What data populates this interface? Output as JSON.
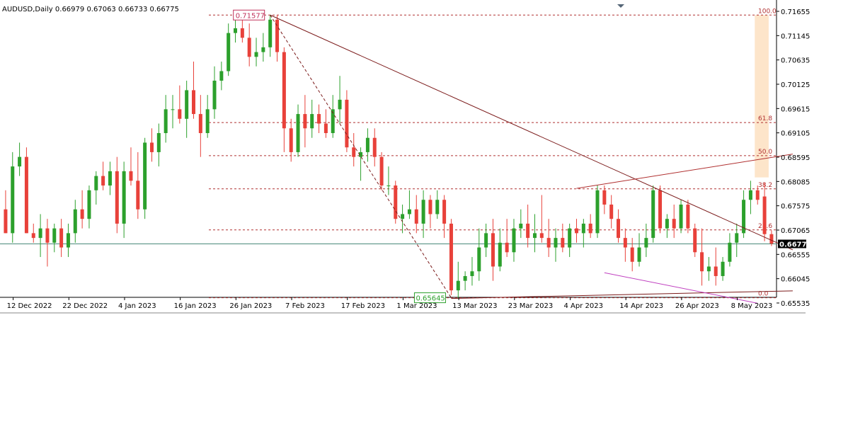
{
  "header": {
    "symbol": "AUDUSD,Daily",
    "ohlc": "0.66979 0.67063 0.66733 0.66775"
  },
  "colors": {
    "bull": "#2ca02c",
    "bear": "#e8413a",
    "trendline": "#7b1a1a",
    "fib": "#b03030",
    "support": "#c040c0",
    "highlight": "#fde2c4",
    "bid_line": "#4a8a7a"
  },
  "chart_data": {
    "type": "candlestick",
    "ylim": [
      0.65535,
      0.71655
    ],
    "y_ticks": [
      "0.71655",
      "0.71145",
      "0.70635",
      "0.70125",
      "0.69615",
      "0.69105",
      "0.68595",
      "0.68085",
      "0.67575",
      "0.67065",
      "0.66555",
      "0.66045",
      "0.65535"
    ],
    "x_labels": [
      {
        "label": "12 Dec 2022",
        "bar": 2
      },
      {
        "label": "22 Dec 2022",
        "bar": 10
      },
      {
        "label": "4 Jan 2023",
        "bar": 18
      },
      {
        "label": "16 Jan 2023",
        "bar": 26
      },
      {
        "label": "26 Jan 2023",
        "bar": 34
      },
      {
        "label": "7 Feb 2023",
        "bar": 42
      },
      {
        "label": "17 Feb 2023",
        "bar": 50
      },
      {
        "label": "1 Mar 2023",
        "bar": 58
      },
      {
        "label": "13 Mar 2023",
        "bar": 66
      },
      {
        "label": "23 Mar 2023",
        "bar": 74
      },
      {
        "label": "4 Apr 2023",
        "bar": 82
      },
      {
        "label": "14 Apr 2023",
        "bar": 90
      },
      {
        "label": "26 Apr 2023",
        "bar": 98
      },
      {
        "label": "8 May 2023",
        "bar": 106
      }
    ],
    "bars": 110,
    "candles": [
      [
        0.675,
        0.679,
        0.67,
        0.67
      ],
      [
        0.67,
        0.687,
        0.668,
        0.684
      ],
      [
        0.684,
        0.689,
        0.682,
        0.686
      ],
      [
        0.686,
        0.688,
        0.67,
        0.67
      ],
      [
        0.67,
        0.672,
        0.668,
        0.669
      ],
      [
        0.669,
        0.674,
        0.665,
        0.671
      ],
      [
        0.671,
        0.673,
        0.663,
        0.668
      ],
      [
        0.668,
        0.672,
        0.666,
        0.671
      ],
      [
        0.671,
        0.673,
        0.665,
        0.667
      ],
      [
        0.667,
        0.672,
        0.665,
        0.67
      ],
      [
        0.67,
        0.677,
        0.668,
        0.675
      ],
      [
        0.675,
        0.679,
        0.671,
        0.673
      ],
      [
        0.673,
        0.68,
        0.671,
        0.679
      ],
      [
        0.679,
        0.683,
        0.676,
        0.682
      ],
      [
        0.682,
        0.685,
        0.679,
        0.68
      ],
      [
        0.68,
        0.685,
        0.678,
        0.683
      ],
      [
        0.683,
        0.686,
        0.67,
        0.672
      ],
      [
        0.672,
        0.685,
        0.669,
        0.683
      ],
      [
        0.683,
        0.688,
        0.68,
        0.681
      ],
      [
        0.681,
        0.687,
        0.673,
        0.675
      ],
      [
        0.675,
        0.69,
        0.673,
        0.689
      ],
      [
        0.689,
        0.692,
        0.685,
        0.687
      ],
      [
        0.687,
        0.693,
        0.684,
        0.691
      ],
      [
        0.691,
        0.699,
        0.689,
        0.696
      ],
      [
        0.696,
        0.699,
        0.692,
        0.696
      ],
      [
        0.696,
        0.701,
        0.693,
        0.694
      ],
      [
        0.694,
        0.702,
        0.69,
        0.7
      ],
      [
        0.7,
        0.706,
        0.694,
        0.695
      ],
      [
        0.695,
        0.699,
        0.686,
        0.691
      ],
      [
        0.691,
        0.699,
        0.69,
        0.696
      ],
      [
        0.696,
        0.705,
        0.694,
        0.702
      ],
      [
        0.702,
        0.706,
        0.7,
        0.704
      ],
      [
        0.704,
        0.714,
        0.703,
        0.712
      ],
      [
        0.712,
        0.715,
        0.71,
        0.713
      ],
      [
        0.713,
        0.715,
        0.71,
        0.711
      ],
      [
        0.711,
        0.714,
        0.705,
        0.707
      ],
      [
        0.707,
        0.711,
        0.705,
        0.708
      ],
      [
        0.708,
        0.712,
        0.706,
        0.709
      ],
      [
        0.709,
        0.7158,
        0.707,
        0.7148
      ],
      [
        0.7148,
        0.7158,
        0.706,
        0.708
      ],
      [
        0.708,
        0.709,
        0.687,
        0.692
      ],
      [
        0.692,
        0.694,
        0.685,
        0.687
      ],
      [
        0.687,
        0.697,
        0.686,
        0.695
      ],
      [
        0.695,
        0.699,
        0.688,
        0.692
      ],
      [
        0.692,
        0.698,
        0.69,
        0.695
      ],
      [
        0.695,
        0.697,
        0.691,
        0.693
      ],
      [
        0.693,
        0.696,
        0.69,
        0.691
      ],
      [
        0.691,
        0.699,
        0.69,
        0.696
      ],
      [
        0.696,
        0.703,
        0.693,
        0.698
      ],
      [
        0.698,
        0.7,
        0.687,
        0.688
      ],
      [
        0.688,
        0.691,
        0.684,
        0.686
      ],
      [
        0.686,
        0.688,
        0.681,
        0.687
      ],
      [
        0.687,
        0.692,
        0.685,
        0.69
      ],
      [
        0.69,
        0.692,
        0.684,
        0.686
      ],
      [
        0.686,
        0.687,
        0.679,
        0.68
      ],
      [
        0.68,
        0.684,
        0.678,
        0.68
      ],
      [
        0.68,
        0.681,
        0.672,
        0.673
      ],
      [
        0.673,
        0.676,
        0.67,
        0.674
      ],
      [
        0.674,
        0.679,
        0.673,
        0.675
      ],
      [
        0.675,
        0.678,
        0.67,
        0.672
      ],
      [
        0.672,
        0.679,
        0.669,
        0.677
      ],
      [
        0.677,
        0.678,
        0.671,
        0.674
      ],
      [
        0.674,
        0.679,
        0.673,
        0.677
      ],
      [
        0.677,
        0.678,
        0.669,
        0.672
      ],
      [
        0.672,
        0.673,
        0.657,
        0.658
      ],
      [
        0.658,
        0.664,
        0.6564,
        0.66
      ],
      [
        0.66,
        0.662,
        0.658,
        0.661
      ],
      [
        0.661,
        0.665,
        0.659,
        0.662
      ],
      [
        0.662,
        0.671,
        0.66,
        0.667
      ],
      [
        0.667,
        0.672,
        0.665,
        0.67
      ],
      [
        0.67,
        0.673,
        0.66,
        0.663
      ],
      [
        0.663,
        0.671,
        0.662,
        0.668
      ],
      [
        0.668,
        0.673,
        0.665,
        0.666
      ],
      [
        0.666,
        0.673,
        0.664,
        0.671
      ],
      [
        0.671,
        0.675,
        0.669,
        0.672
      ],
      [
        0.672,
        0.676,
        0.667,
        0.669
      ],
      [
        0.669,
        0.674,
        0.666,
        0.67
      ],
      [
        0.67,
        0.678,
        0.668,
        0.669
      ],
      [
        0.669,
        0.673,
        0.665,
        0.667
      ],
      [
        0.667,
        0.671,
        0.664,
        0.669
      ],
      [
        0.669,
        0.672,
        0.666,
        0.667
      ],
      [
        0.667,
        0.672,
        0.665,
        0.671
      ],
      [
        0.671,
        0.673,
        0.668,
        0.67
      ],
      [
        0.67,
        0.673,
        0.667,
        0.672
      ],
      [
        0.672,
        0.674,
        0.669,
        0.67
      ],
      [
        0.67,
        0.68,
        0.669,
        0.679
      ],
      [
        0.679,
        0.68,
        0.674,
        0.676
      ],
      [
        0.676,
        0.678,
        0.671,
        0.673
      ],
      [
        0.673,
        0.675,
        0.668,
        0.669
      ],
      [
        0.669,
        0.671,
        0.664,
        0.667
      ],
      [
        0.667,
        0.669,
        0.662,
        0.664
      ],
      [
        0.664,
        0.67,
        0.663,
        0.667
      ],
      [
        0.667,
        0.672,
        0.665,
        0.669
      ],
      [
        0.669,
        0.68,
        0.668,
        0.679
      ],
      [
        0.679,
        0.68,
        0.67,
        0.671
      ],
      [
        0.671,
        0.674,
        0.669,
        0.673
      ],
      [
        0.673,
        0.676,
        0.669,
        0.671
      ],
      [
        0.671,
        0.677,
        0.67,
        0.676
      ],
      [
        0.676,
        0.677,
        0.67,
        0.671
      ],
      [
        0.671,
        0.672,
        0.665,
        0.666
      ],
      [
        0.666,
        0.671,
        0.659,
        0.662
      ],
      [
        0.662,
        0.665,
        0.66,
        0.663
      ],
      [
        0.663,
        0.667,
        0.659,
        0.661
      ],
      [
        0.661,
        0.665,
        0.66,
        0.664
      ],
      [
        0.664,
        0.67,
        0.663,
        0.668
      ],
      [
        0.668,
        0.672,
        0.665,
        0.67
      ],
      [
        0.67,
        0.679,
        0.669,
        0.677
      ],
      [
        0.677,
        0.681,
        0.674,
        0.679
      ],
      [
        0.679,
        0.68,
        0.676,
        0.677
      ],
      [
        0.6777,
        0.6806,
        0.6683,
        0.6698
      ],
      [
        0.6698,
        0.6706,
        0.6673,
        0.6678
      ]
    ],
    "bid": {
      "value": 0.66775,
      "label": "0.66775"
    },
    "fib_levels": [
      {
        "label": "100.0",
        "value": 0.71577
      },
      {
        "label": "61.8",
        "value": 0.69321
      },
      {
        "label": "50.0",
        "value": 0.68626
      },
      {
        "label": "38.2",
        "value": 0.6793
      },
      {
        "label": "23.6",
        "value": 0.67068
      },
      {
        "label": "0.0",
        "value": 0.65645
      }
    ],
    "annotations": {
      "high_label": "0.71577",
      "low_label": "0.65645"
    },
    "trendlines": [
      {
        "name": "downtrend",
        "x1": 38,
        "y1": 0.71577,
        "x2": 110,
        "y2": 0.6665
      },
      {
        "name": "upper-channel",
        "x1": 82,
        "y1": 0.6794,
        "x2": 110,
        "y2": 0.6866
      },
      {
        "name": "lower-support",
        "x1": 64,
        "y1": 0.6563,
        "x2": 110,
        "y2": 0.6579
      },
      {
        "name": "magenta-support",
        "x1": 86,
        "y1": 0.6617,
        "x2": 108,
        "y2": 0.6553
      },
      {
        "name": "dashed-swing",
        "x1": 38,
        "y1": 0.71577,
        "x2": 64,
        "y2": 0.65645
      }
    ],
    "highlight_zone": {
      "x1": 108,
      "x2": 110,
      "y_top": 0.71577,
      "y_bottom": 0.6817
    },
    "grid": false,
    "legend": "none"
  }
}
